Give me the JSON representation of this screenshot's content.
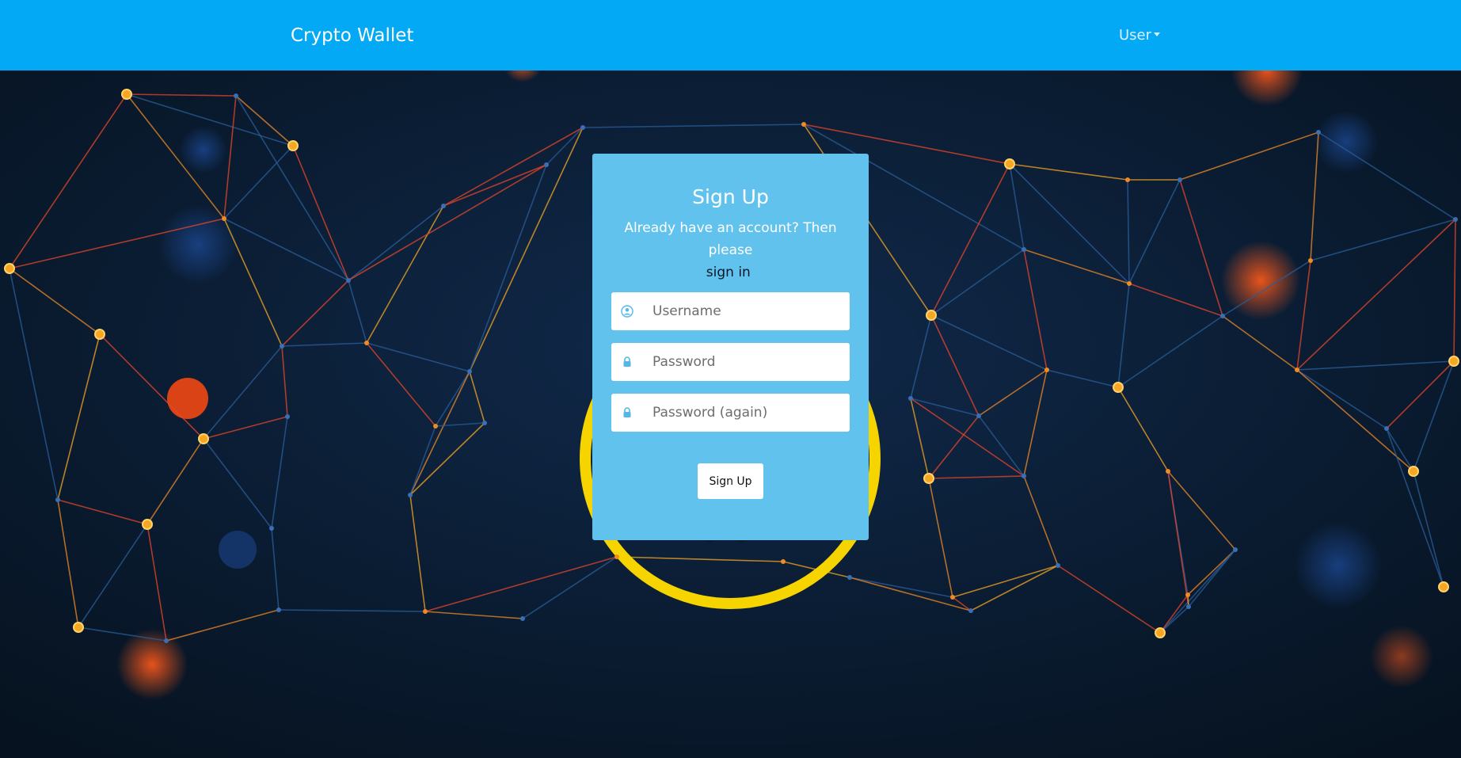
{
  "navbar": {
    "brand": "Crypto Wallet",
    "user_menu_label": "User"
  },
  "colors": {
    "navbar": "#03a9f4",
    "card": "#62c2ee",
    "background": "#0a1a2e",
    "node_orange": "#f5a623",
    "line_red": "#e8462a",
    "line_blue": "#2a5d9a",
    "coin_yellow": "#f5d400"
  },
  "signup": {
    "title": "Sign Up",
    "subtitle_text": "Already have an account? Then please",
    "signin_link": "sign in",
    "subtitle_end": ".",
    "username": {
      "placeholder": "Username",
      "value": "",
      "icon": "user-icon"
    },
    "password": {
      "placeholder": "Password",
      "value": "",
      "icon": "lock-icon"
    },
    "password_again": {
      "placeholder": "Password (again)",
      "value": "",
      "icon": "lock-icon"
    },
    "submit_label": "Sign Up"
  },
  "background": {
    "image": "crypto network nodes with bitcoin coin"
  }
}
